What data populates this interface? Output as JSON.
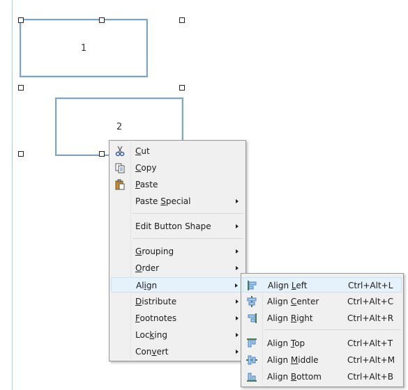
{
  "canvas": {
    "shape1_label": "1",
    "shape2_label": "2"
  },
  "context_menu": {
    "items": [
      {
        "pre": "",
        "ul": "C",
        "post": "ut",
        "icon": "scissors-icon",
        "submenu": false
      },
      {
        "pre": "",
        "ul": "C",
        "post": "opy",
        "icon": "copy-icon",
        "submenu": false
      },
      {
        "pre": "",
        "ul": "P",
        "post": "aste",
        "icon": "paste-icon",
        "submenu": false
      },
      {
        "pre": "Paste ",
        "ul": "S",
        "post": "pecial",
        "icon": "",
        "submenu": true
      },
      {
        "pre": "Edit Button Shape",
        "ul": "",
        "post": "",
        "icon": "",
        "submenu": true
      },
      {
        "pre": "",
        "ul": "G",
        "post": "rouping",
        "icon": "",
        "submenu": true
      },
      {
        "pre": "",
        "ul": "O",
        "post": "rder",
        "icon": "",
        "submenu": true
      },
      {
        "pre": "Al",
        "ul": "i",
        "post": "gn",
        "icon": "",
        "submenu": true
      },
      {
        "pre": "",
        "ul": "D",
        "post": "istribute",
        "icon": "",
        "submenu": true
      },
      {
        "pre": "",
        "ul": "F",
        "post": "ootnotes",
        "icon": "",
        "submenu": true
      },
      {
        "pre": "Loc",
        "ul": "k",
        "post": "ing",
        "icon": "",
        "submenu": true
      },
      {
        "pre": "Con",
        "ul": "v",
        "post": "ert",
        "icon": "",
        "submenu": true
      }
    ]
  },
  "align_submenu": {
    "items": [
      {
        "pre": "Align ",
        "ul": "L",
        "post": "eft",
        "shortcut": "Ctrl+Alt+L",
        "icon": "align-left-icon"
      },
      {
        "pre": "Align ",
        "ul": "C",
        "post": "enter",
        "shortcut": "Ctrl+Alt+C",
        "icon": "align-center-icon"
      },
      {
        "pre": "Align ",
        "ul": "R",
        "post": "ight",
        "shortcut": "Ctrl+Alt+R",
        "icon": "align-right-icon"
      },
      {
        "pre": "Align ",
        "ul": "T",
        "post": "op",
        "shortcut": "Ctrl+Alt+T",
        "icon": "align-top-icon"
      },
      {
        "pre": "Align ",
        "ul": "M",
        "post": "iddle",
        "shortcut": "Ctrl+Alt+M",
        "icon": "align-middle-icon"
      },
      {
        "pre": "Align ",
        "ul": "B",
        "post": "ottom",
        "shortcut": "Ctrl+Alt+B",
        "icon": "align-bottom-icon"
      }
    ]
  }
}
